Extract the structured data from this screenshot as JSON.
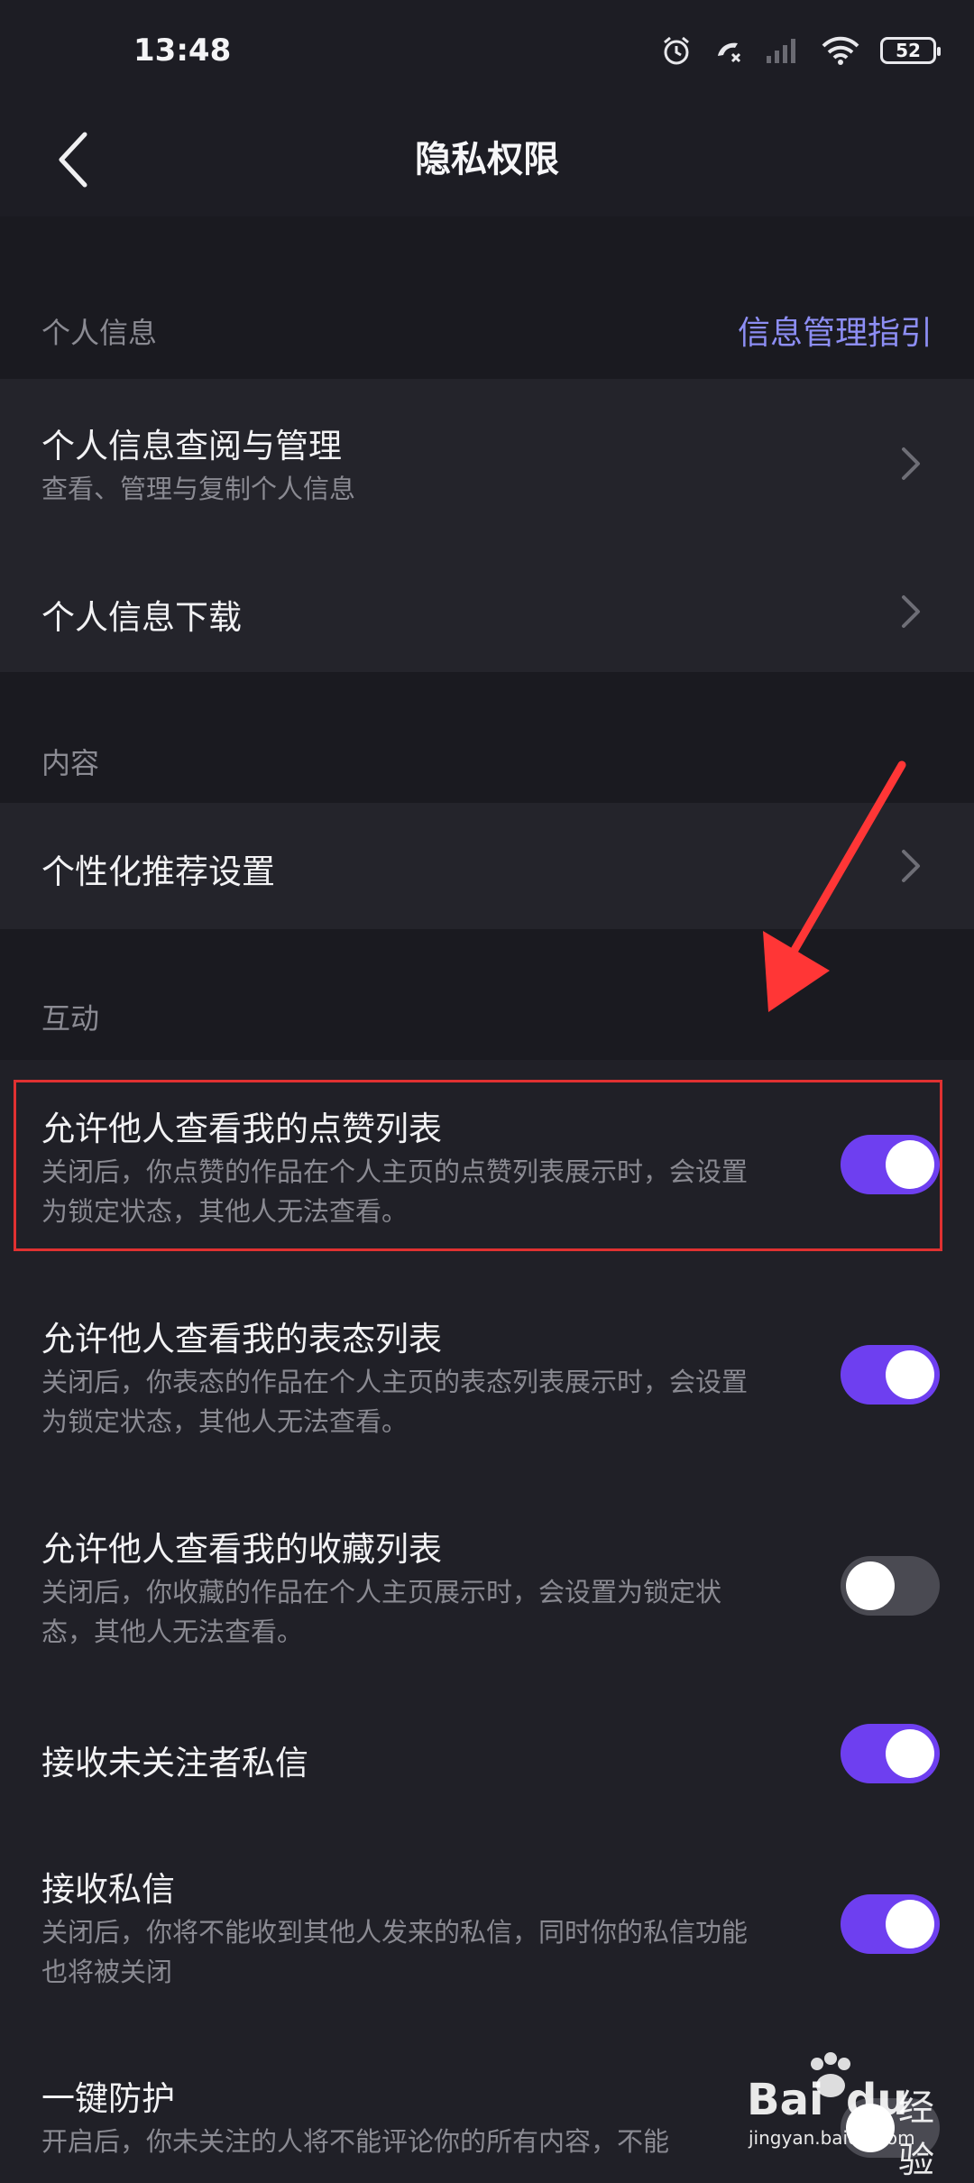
{
  "status_bar": {
    "time": "13:48",
    "battery": "52"
  },
  "nav": {
    "title": "隐私权限"
  },
  "sections": {
    "personal": {
      "label": "个人信息",
      "link": "信息管理指引"
    },
    "content": {
      "label": "内容"
    },
    "interaction": {
      "label": "互动"
    }
  },
  "personal_items": [
    {
      "title": "个人信息查阅与管理",
      "subtitle": "查看、管理与复制个人信息"
    },
    {
      "title": "个人信息下载"
    }
  ],
  "content_items": [
    {
      "title": "个性化推荐设置"
    }
  ],
  "interaction_items": [
    {
      "title": "允许他人查看我的点赞列表",
      "subtitle": "关闭后，你点赞的作品在个人主页的点赞列表展示时，会设置为锁定状态，其他人无法查看。",
      "enabled": true
    },
    {
      "title": "允许他人查看我的表态列表",
      "subtitle": "关闭后，你表态的作品在个人主页的表态列表展示时，会设置为锁定状态，其他人无法查看。",
      "enabled": true
    },
    {
      "title": "允许他人查看我的收藏列表",
      "subtitle": "关闭后，你收藏的作品在个人主页展示时，会设置为锁定状态，其他人无法查看。",
      "enabled": false
    },
    {
      "title": "接收未关注者私信",
      "enabled": true
    },
    {
      "title": "接收私信",
      "subtitle": "关闭后，你将不能收到其他人发来的私信，同时你的私信功能也将被关闭",
      "enabled": true
    },
    {
      "title": "一键防护",
      "subtitle": "开启后，你未关注的人将不能评论你的所有内容，不能",
      "enabled": false
    }
  ],
  "watermark": {
    "brand": "Bai",
    "brand_end": "du",
    "cn": "经验",
    "url": "jingyan.baidu.com"
  },
  "colors": {
    "accent": "#6e3ff0",
    "link": "#8d8ef4",
    "highlight": "#e03131"
  }
}
